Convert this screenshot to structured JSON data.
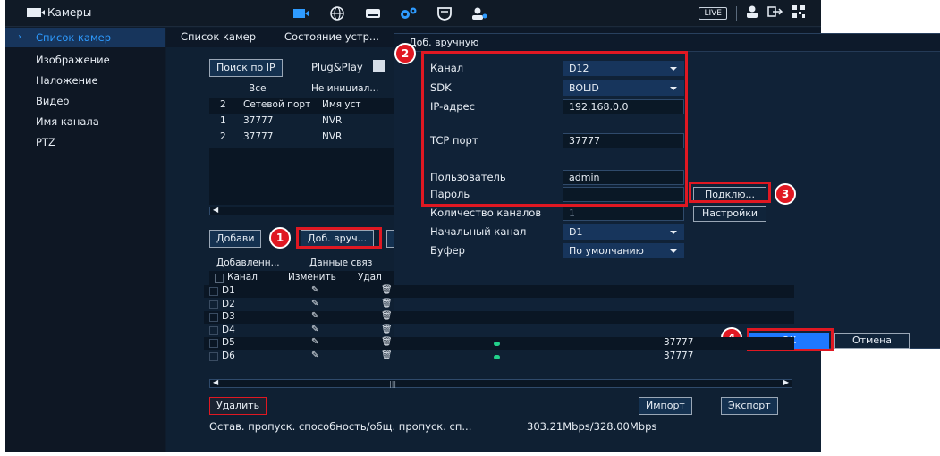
{
  "topbar": {
    "title": "Камеры",
    "live": "LIVE",
    "icons": [
      "camera-icon",
      "globe-icon",
      "storage-icon",
      "settings-gear-icon",
      "shield-icon",
      "user-settings-icon"
    ],
    "right_icons": [
      "user-icon",
      "logout-icon",
      "qr-code-icon"
    ]
  },
  "sidebar": {
    "items": [
      {
        "label": "Список камер",
        "active": true
      },
      {
        "label": "Изображение"
      },
      {
        "label": "Наложение"
      },
      {
        "label": "Видео"
      },
      {
        "label": "Имя канала"
      },
      {
        "label": "PTZ"
      }
    ]
  },
  "tabs": [
    "Список камер",
    "Состояние устр..."
  ],
  "search": {
    "search_ip": "Поиск по IP",
    "plug_play": "Plug&Play"
  },
  "device_filter": {
    "all": "Все",
    "uninit": "Не инициал..."
  },
  "device_table": {
    "headers": [
      "2",
      "Сетевой порт",
      "Имя уст"
    ],
    "rows": [
      [
        "1",
        "37777",
        "NVR"
      ],
      [
        "2",
        "37777",
        "NVR"
      ]
    ]
  },
  "buttons": {
    "add": "Добави",
    "add_manual": "Доб. вруч...",
    "delete": "Удалить",
    "import": "Импорт",
    "export": "Экспорт"
  },
  "added_tabs": [
    "Добавленн...",
    "Данные связ"
  ],
  "added_table": {
    "headers": [
      "Канал",
      "Изменить",
      "Удал"
    ],
    "rows": [
      {
        "ch": "D1"
      },
      {
        "ch": "D2"
      },
      {
        "ch": "D3"
      },
      {
        "ch": "D4"
      },
      {
        "ch": "D5",
        "port": "37777",
        "online": true
      },
      {
        "ch": "D6",
        "port": "37777",
        "online": true
      }
    ]
  },
  "bandwidth": {
    "label": "Остав. пропуск. способность/общ. пропуск. сп...",
    "value": "303.21Mbps/328.00Mbps"
  },
  "dialog": {
    "title": "Доб. вручную",
    "fields": {
      "channel": {
        "label": "Канал",
        "value": "D12"
      },
      "sdk": {
        "label": "SDK",
        "value": "BOLID"
      },
      "ip": {
        "label": "IP-адрес",
        "value": "192.168.0.0"
      },
      "tcp": {
        "label": "TCP порт",
        "value": "37777"
      },
      "user": {
        "label": "Пользователь",
        "value": "admin"
      },
      "password": {
        "label": "Пароль",
        "value": ""
      },
      "ch_count": {
        "label": "Количество каналов",
        "value": "1"
      },
      "start_ch": {
        "label": "Начальный канал",
        "value": "D1"
      },
      "buffer": {
        "label": "Буфер",
        "value": "По умолчанию"
      }
    },
    "connect": "Подклю...",
    "settings": "Настройки",
    "ok": "OK",
    "cancel": "Отмена"
  },
  "badges": [
    "1",
    "2",
    "3",
    "4"
  ],
  "colors": {
    "annotation_red": "#e01822",
    "accent_blue": "#2e9bff",
    "selected_bg": "#17355c",
    "ok_blue": "#1e78ff"
  }
}
